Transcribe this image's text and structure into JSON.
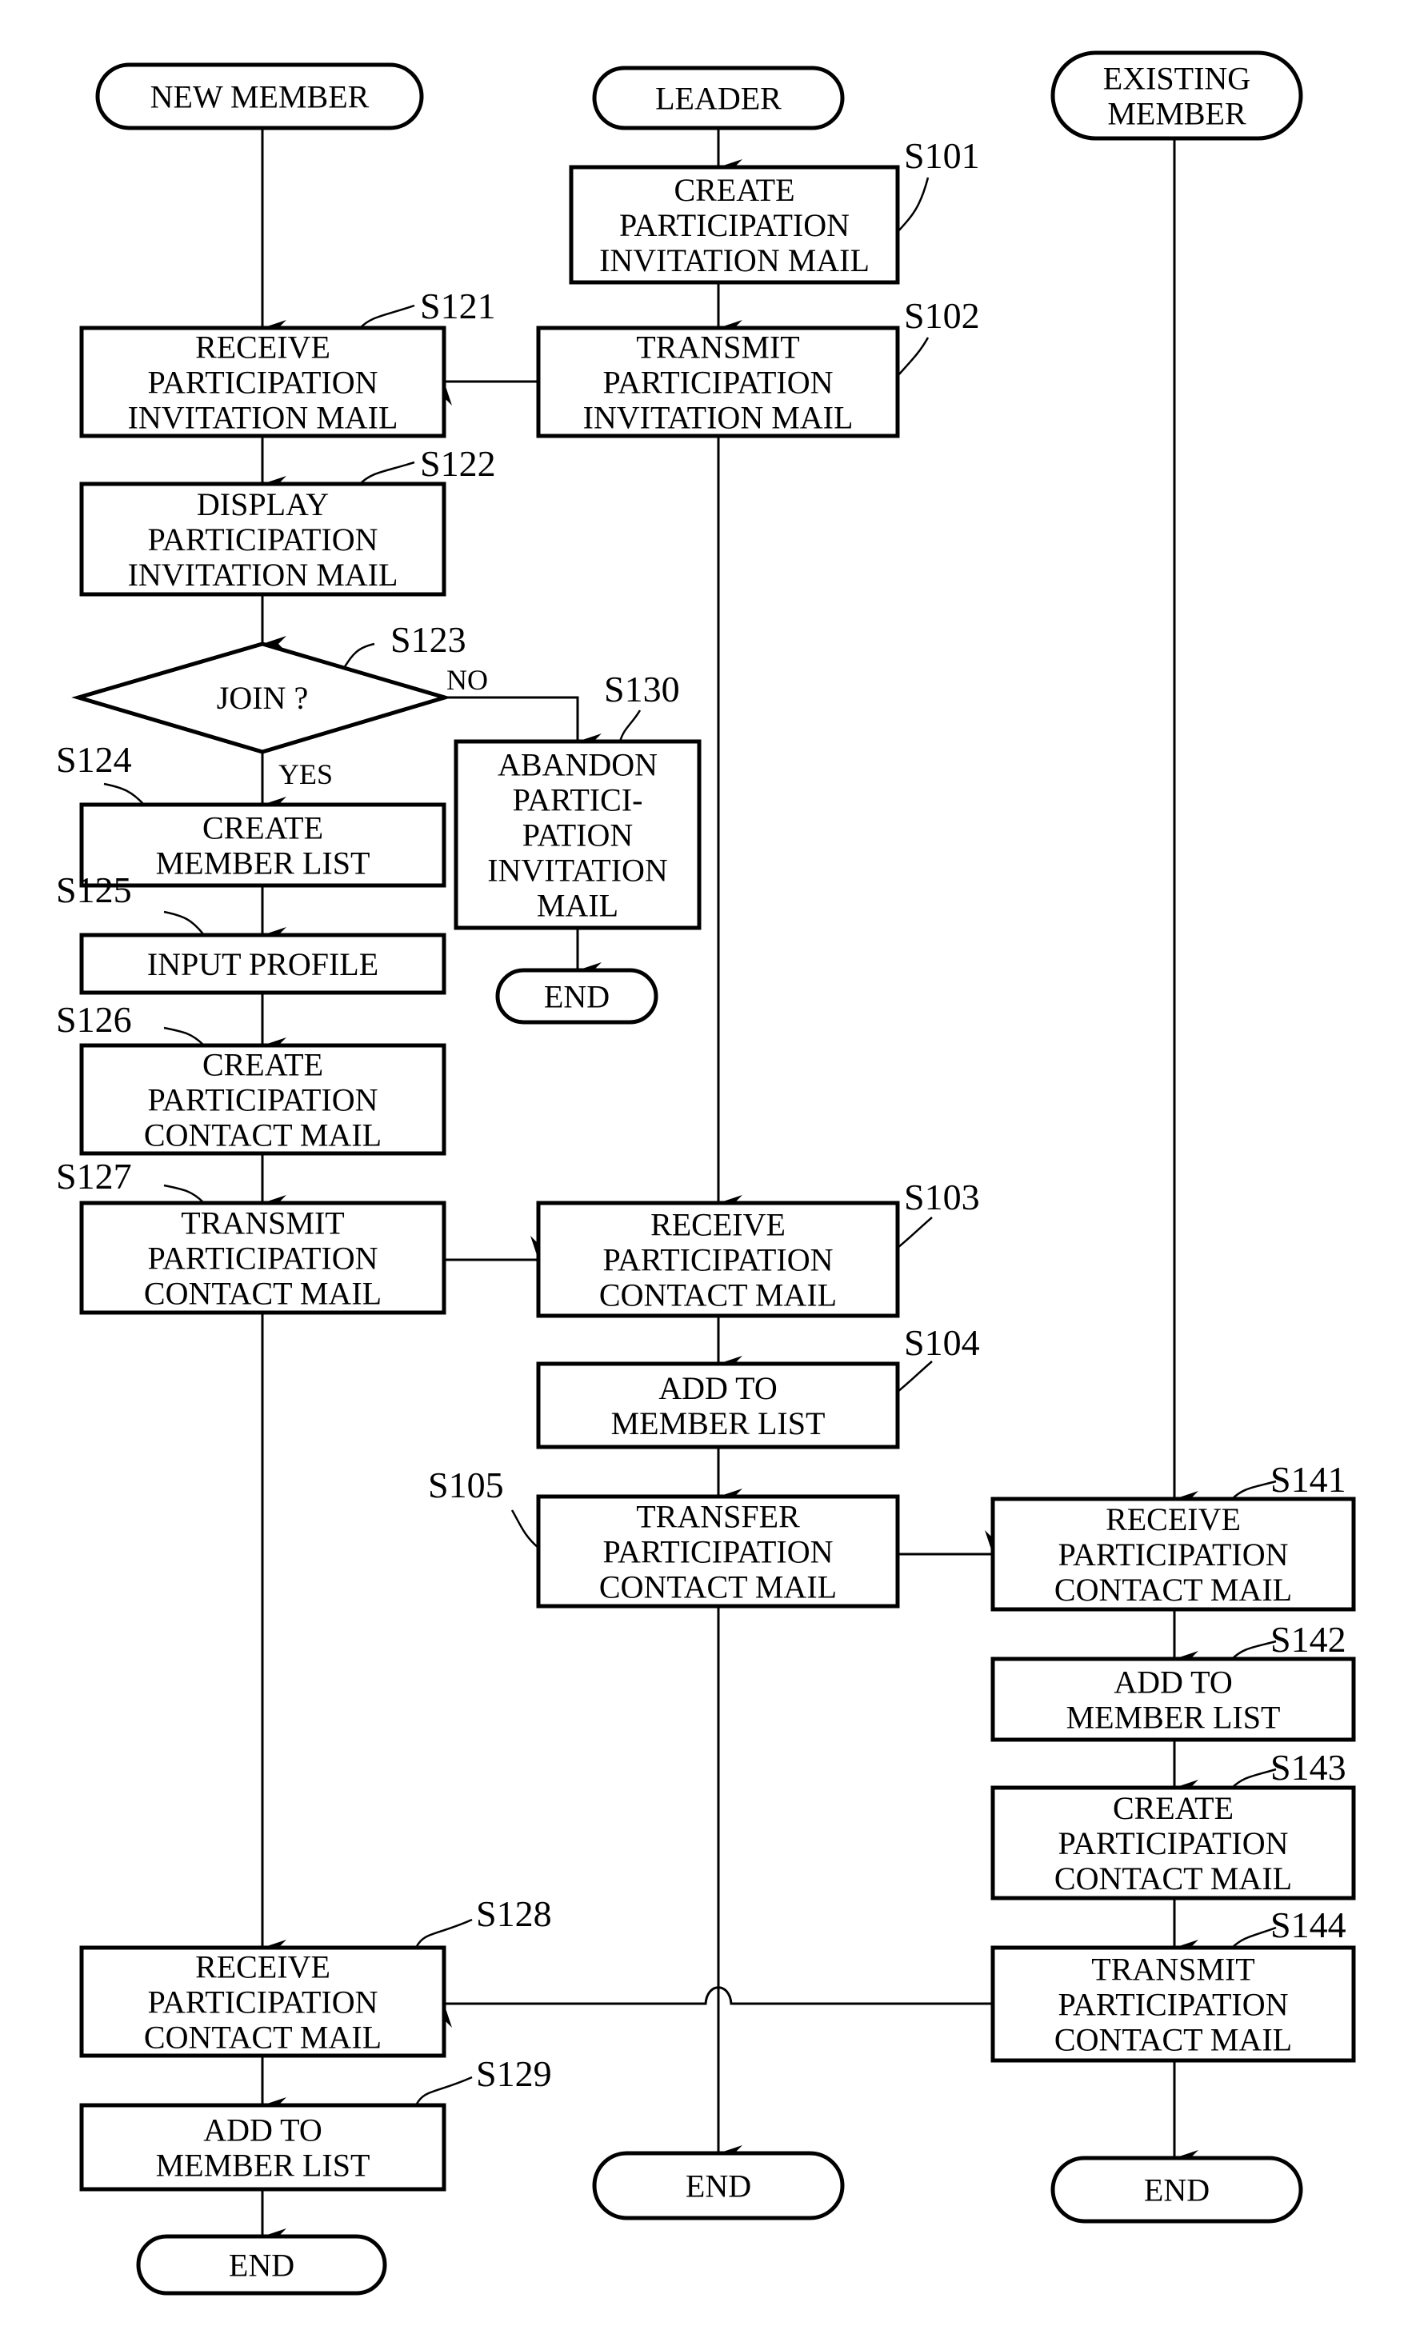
{
  "lanes": {
    "new_member": "NEW MEMBER",
    "leader": "LEADER",
    "existing_member": [
      "EXISTING",
      "MEMBER"
    ]
  },
  "steps": {
    "S101": {
      "id": "S101",
      "lines": [
        "CREATE",
        "PARTICIPATION",
        "INVITATION MAIL"
      ]
    },
    "S102": {
      "id": "S102",
      "lines": [
        "TRANSMIT",
        "PARTICIPATION",
        "INVITATION MAIL"
      ]
    },
    "S103": {
      "id": "S103",
      "lines": [
        "RECEIVE",
        "PARTICIPATION",
        "CONTACT MAIL"
      ]
    },
    "S104": {
      "id": "S104",
      "lines": [
        "ADD TO",
        "MEMBER LIST"
      ]
    },
    "S105": {
      "id": "S105",
      "lines": [
        "TRANSFER",
        "PARTICIPATION",
        "CONTACT MAIL"
      ]
    },
    "S121": {
      "id": "S121",
      "lines": [
        "RECEIVE",
        "PARTICIPATION",
        "INVITATION MAIL"
      ]
    },
    "S122": {
      "id": "S122",
      "lines": [
        "DISPLAY",
        "PARTICIPATION",
        "INVITATION MAIL"
      ]
    },
    "S123": {
      "id": "S123",
      "lines": [
        "JOIN ?"
      ]
    },
    "S124": {
      "id": "S124",
      "lines": [
        "CREATE",
        "MEMBER LIST"
      ]
    },
    "S125": {
      "id": "S125",
      "lines": [
        "INPUT PROFILE"
      ]
    },
    "S126": {
      "id": "S126",
      "lines": [
        "CREATE",
        "PARTICIPATION",
        "CONTACT MAIL"
      ]
    },
    "S127": {
      "id": "S127",
      "lines": [
        "TRANSMIT",
        "PARTICIPATION",
        "CONTACT MAIL"
      ]
    },
    "S128": {
      "id": "S128",
      "lines": [
        "RECEIVE",
        "PARTICIPATION",
        "CONTACT MAIL"
      ]
    },
    "S129": {
      "id": "S129",
      "lines": [
        "ADD TO",
        "MEMBER LIST"
      ]
    },
    "S130": {
      "id": "S130",
      "lines": [
        "ABANDON",
        "PARTICI-",
        "PATION",
        "INVITATION",
        "MAIL"
      ]
    },
    "S141": {
      "id": "S141",
      "lines": [
        "RECEIVE",
        "PARTICIPATION",
        "CONTACT MAIL"
      ]
    },
    "S142": {
      "id": "S142",
      "lines": [
        "ADD TO",
        "MEMBER LIST"
      ]
    },
    "S143": {
      "id": "S143",
      "lines": [
        "CREATE",
        "PARTICIPATION",
        "CONTACT MAIL"
      ]
    },
    "S144": {
      "id": "S144",
      "lines": [
        "TRANSMIT",
        "PARTICIPATION",
        "CONTACT MAIL"
      ]
    }
  },
  "branch": {
    "yes": "YES",
    "no": "NO"
  },
  "end_label": "END"
}
